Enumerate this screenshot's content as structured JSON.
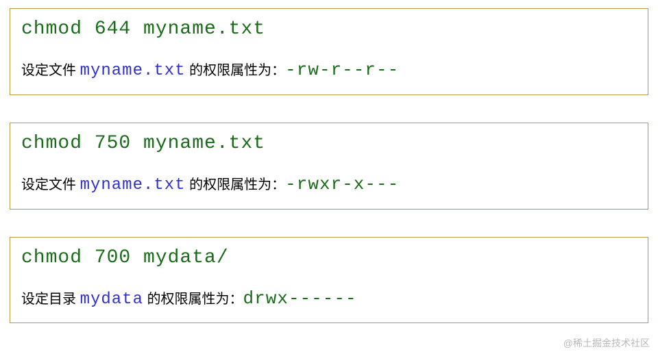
{
  "examples": [
    {
      "command": "chmod 644 myname.txt",
      "desc_prefix": "设定文件 ",
      "filename": "myname.txt",
      "desc_mid": " 的权限属性为：",
      "perms": "-rw-r--r--"
    },
    {
      "command": "chmod 750 myname.txt",
      "desc_prefix": "设定文件 ",
      "filename": "myname.txt",
      "desc_mid": " 的权限属性为：",
      "perms": "-rwxr-x---"
    },
    {
      "command": "chmod 700 mydata/",
      "desc_prefix": "设定目录 ",
      "filename": "mydata",
      "desc_mid": " 的权限属性为：",
      "perms": "drwx------"
    }
  ],
  "watermark": "@稀土掘金技术社区"
}
